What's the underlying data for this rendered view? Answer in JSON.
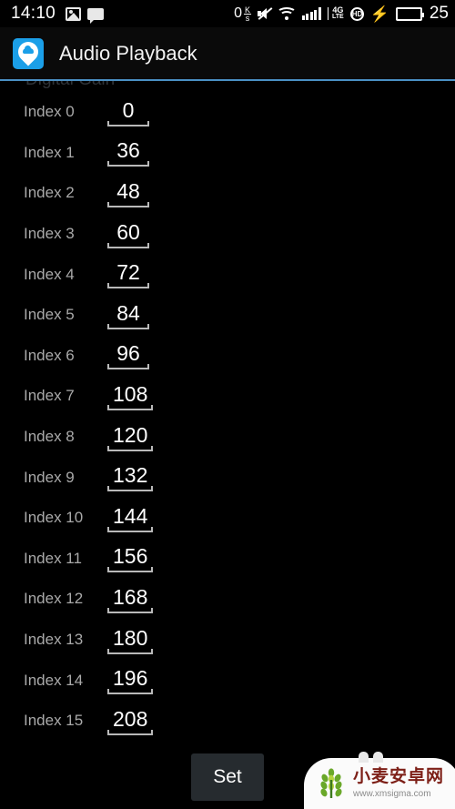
{
  "statusbar": {
    "clock": "14:10",
    "photo_icon": "photo-icon",
    "message_icon": "message-icon",
    "data_rate": "0",
    "data_rate_unit_top": "K",
    "data_rate_unit_bottom": "s",
    "mute_icon": "mute-icon",
    "wifi_icon": "wifi-icon",
    "signal_icon": "signal-bars-icon",
    "network_type": "4G",
    "network_sub": "LTE",
    "hd_label": "HD",
    "charging_icon": "lightning-bolt-icon",
    "battery_icon": "battery-icon",
    "battery_color": "#3ddc3d",
    "battery_percent": "25"
  },
  "appbar": {
    "icon_name": "app-launcher-icon",
    "icon_color": "#1b9fe8",
    "title": "Audio Playback"
  },
  "divider_color": "#4a90c4",
  "content": {
    "section_title": "Digital Gain",
    "rows": [
      {
        "label": "Index 0",
        "value": "0"
      },
      {
        "label": "Index 1",
        "value": "36"
      },
      {
        "label": "Index 2",
        "value": "48"
      },
      {
        "label": "Index 3",
        "value": "60"
      },
      {
        "label": "Index 4",
        "value": "72"
      },
      {
        "label": "Index 5",
        "value": "84"
      },
      {
        "label": "Index 6",
        "value": "96"
      },
      {
        "label": "Index 7",
        "value": "108"
      },
      {
        "label": "Index 8",
        "value": "120"
      },
      {
        "label": "Index 9",
        "value": "132"
      },
      {
        "label": "Index 10",
        "value": "144"
      },
      {
        "label": "Index 11",
        "value": "156"
      },
      {
        "label": "Index 12",
        "value": "168"
      },
      {
        "label": "Index 13",
        "value": "180"
      },
      {
        "label": "Index 14",
        "value": "196"
      },
      {
        "label": "Index 15",
        "value": "208"
      }
    ]
  },
  "bottom": {
    "set_label": "Set"
  },
  "watermark": {
    "logo_name": "wheat-logo-icon",
    "site_name": "小麦安卓网",
    "url": "www.xmsigma.com"
  }
}
